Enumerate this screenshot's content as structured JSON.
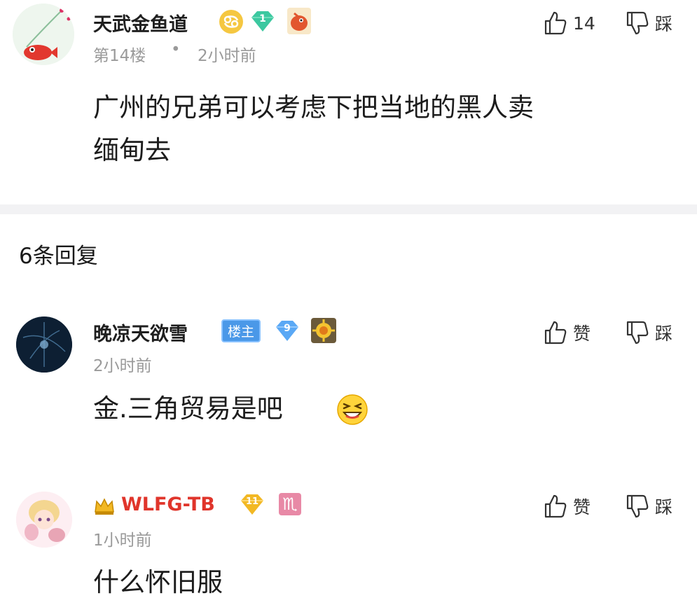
{
  "post": {
    "username": "天武金鱼道",
    "level": "1",
    "floor": "第14楼",
    "separator": "•",
    "time": "2小时前",
    "content_line1": "广州的兄弟可以考虑下把当地的黑人卖",
    "content_line2": "缅甸去",
    "like_count": "14",
    "dislike_label": "踩"
  },
  "replies_header": "6条回复",
  "replies": [
    {
      "username": "晚凉天欲雪",
      "host_badge": "楼主",
      "level": "9",
      "time": "2小时前",
      "content": "金.三角贸易是吧",
      "like_label": "赞",
      "dislike_label": "踩"
    },
    {
      "username": "WLFG-TB",
      "level": "11",
      "zodiac": "♏",
      "time": "1小时前",
      "content": "什么怀旧服",
      "like_label": "赞",
      "dislike_label": "踩"
    }
  ],
  "colors": {
    "vip_name": "#e0352b",
    "level_green": "#3cc8a0",
    "level_blue": "#5aa8f5",
    "level_gold": "#f2b824",
    "zodiac_pink": "#e889a6",
    "host_badge_blue": "#4a98e8"
  },
  "icons": [
    "thumbs-up-icon",
    "thumbs-down-icon",
    "cancer-zodiac-icon",
    "diamond-level-icon",
    "bird-medal-icon",
    "sun-medal-icon",
    "crown-icon",
    "grinning-emoji-icon"
  ]
}
